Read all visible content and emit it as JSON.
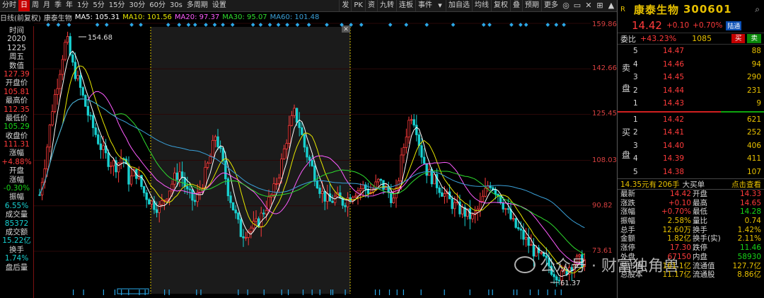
{
  "toolbar": {
    "left": [
      "分时",
      "日",
      "周",
      "月",
      "季",
      "年",
      "1分",
      "5分",
      "15分",
      "30分",
      "60分",
      "30s",
      "多周期",
      "设置"
    ],
    "right": [
      "发",
      "PK",
      "资",
      "九转",
      "连板",
      "事件",
      "加自选",
      "均线",
      "复权",
      "叠",
      "预期",
      "更多"
    ],
    "icons": [
      "◎",
      "▭",
      "✕",
      "⊞",
      "▲"
    ]
  },
  "indicator_line": {
    "period": "日线(前复权)",
    "stock": "康泰生物",
    "ma5": "MA5: 105.31",
    "ma10": "MA10: 101.56",
    "ma20": "MA20: 97.37",
    "ma30": "MA30: 95.07",
    "ma60": "MA60: 101.48"
  },
  "left_panel": [
    {
      "label": "时间",
      "value": "2020"
    },
    {
      "label": "1225",
      "value": "周五"
    },
    {
      "label": "数值",
      "value": "127.39"
    },
    {
      "label": "开盘价",
      "value": "105.81"
    },
    {
      "label": "最高价",
      "value": "112.35"
    },
    {
      "label": "最低价",
      "value": "105.29"
    },
    {
      "label": "收盘价",
      "value": "111.31"
    },
    {
      "label": "涨幅",
      "value": "+4.88%"
    },
    {
      "label": "开盘",
      "value": ""
    },
    {
      "label": "涨幅",
      "value": "-0.30%"
    },
    {
      "label": "振幅",
      "value": "6.55%"
    },
    {
      "label": "成交量",
      "value": "85372"
    },
    {
      "label": "成交额",
      "value": "15.22亿"
    },
    {
      "label": "换手",
      "value": "1.74%"
    },
    {
      "label": "盘后量",
      "value": ""
    }
  ],
  "axis": {
    "labels": [
      "159.86",
      "142.66",
      "125.45",
      "108.03",
      "90.82",
      "73.61"
    ],
    "high_label": "154.68",
    "low_label": "61.37"
  },
  "watermark": "公众号 · 财富独角兽",
  "right_panel": {
    "mark": "R",
    "name": "康泰生物",
    "code": "300601",
    "price": "14.42",
    "change": "+0.10",
    "change_pct": "+0.70%",
    "badge": "陆通",
    "weibi_label": "委比",
    "weibi_pct": "+43.23%",
    "weibi_vol": "1085",
    "buy_label": "买",
    "sell_label": "卖",
    "sell_side": [
      "卖",
      "盘"
    ],
    "buy_side": [
      "买",
      "盘"
    ],
    "asks": [
      {
        "level": "5",
        "price": "14.47",
        "vol": "88"
      },
      {
        "level": "4",
        "price": "14.46",
        "vol": "94"
      },
      {
        "level": "3",
        "price": "14.45",
        "vol": "290"
      },
      {
        "level": "2",
        "price": "14.44",
        "vol": "231"
      },
      {
        "level": "1",
        "price": "14.43",
        "vol": "9"
      }
    ],
    "bids": [
      {
        "level": "1",
        "price": "14.42",
        "vol": "621"
      },
      {
        "level": "2",
        "price": "14.41",
        "vol": "252"
      },
      {
        "level": "3",
        "price": "14.40",
        "vol": "406"
      },
      {
        "level": "4",
        "price": "14.39",
        "vol": "411"
      },
      {
        "level": "5",
        "price": "14.38",
        "vol": "107"
      }
    ],
    "bar": {
      "amount": "14.35元有",
      "hands": "206手",
      "big": "大买单",
      "link": "点击查看"
    },
    "stats": [
      {
        "l1": "最新",
        "v1": "14.42",
        "c1": "#ff3b3b",
        "l2": "开盘",
        "v2": "14.33",
        "c2": "#ff3b3b"
      },
      {
        "l1": "涨跌",
        "v1": "+0.10",
        "c1": "#ff3b3b",
        "l2": "最高",
        "v2": "14.65",
        "c2": "#ff3b3b"
      },
      {
        "l1": "涨幅",
        "v1": "+0.70%",
        "c1": "#ff3b3b",
        "l2": "最低",
        "v2": "14.28",
        "c2": "#17d417"
      },
      {
        "l1": "振幅",
        "v1": "2.58%",
        "c1": "#e7c000",
        "l2": "量比",
        "v2": "0.74",
        "c2": "#e7c000"
      },
      {
        "l1": "总手",
        "v1": "12.60万",
        "c1": "#e7c000",
        "l2": "换手",
        "v2": "1.42%",
        "c2": "#e7c000"
      },
      {
        "l1": "金额",
        "v1": "1.82亿",
        "c1": "#e7c000",
        "l2": "换手(实)",
        "v2": "2.11%",
        "c2": "#e7c000"
      },
      {
        "l1": "涨停",
        "v1": "17.30",
        "c1": "#ff3b3b",
        "l2": "跌停",
        "v2": "11.46",
        "c2": "#17d417"
      },
      {
        "l1": "外盘",
        "v1": "67150",
        "c1": "#ff3b3b",
        "l2": "内盘",
        "v2": "58930",
        "c2": "#17d417"
      },
      {
        "l1": "总市值",
        "v1": "161.1亿",
        "c1": "#e7c000",
        "l2": "流通值",
        "v2": "127.7亿",
        "c2": "#e7c000"
      },
      {
        "l1": "总股本",
        "v1": "11.17亿",
        "c1": "#e7c000",
        "l2": "流通股",
        "v2": "8.86亿",
        "c2": "#e7c000"
      }
    ]
  },
  "colors": {
    "up": "#ff3b3b",
    "down": "#18d0d0",
    "ma5": "#ffffff",
    "ma10": "#e7e700",
    "ma20": "#ff5cff",
    "ma30": "#2edc2e",
    "ma60": "#3aa0d8",
    "highlight_bg": "#1b1b1b",
    "accent": "#e7c000"
  }
}
